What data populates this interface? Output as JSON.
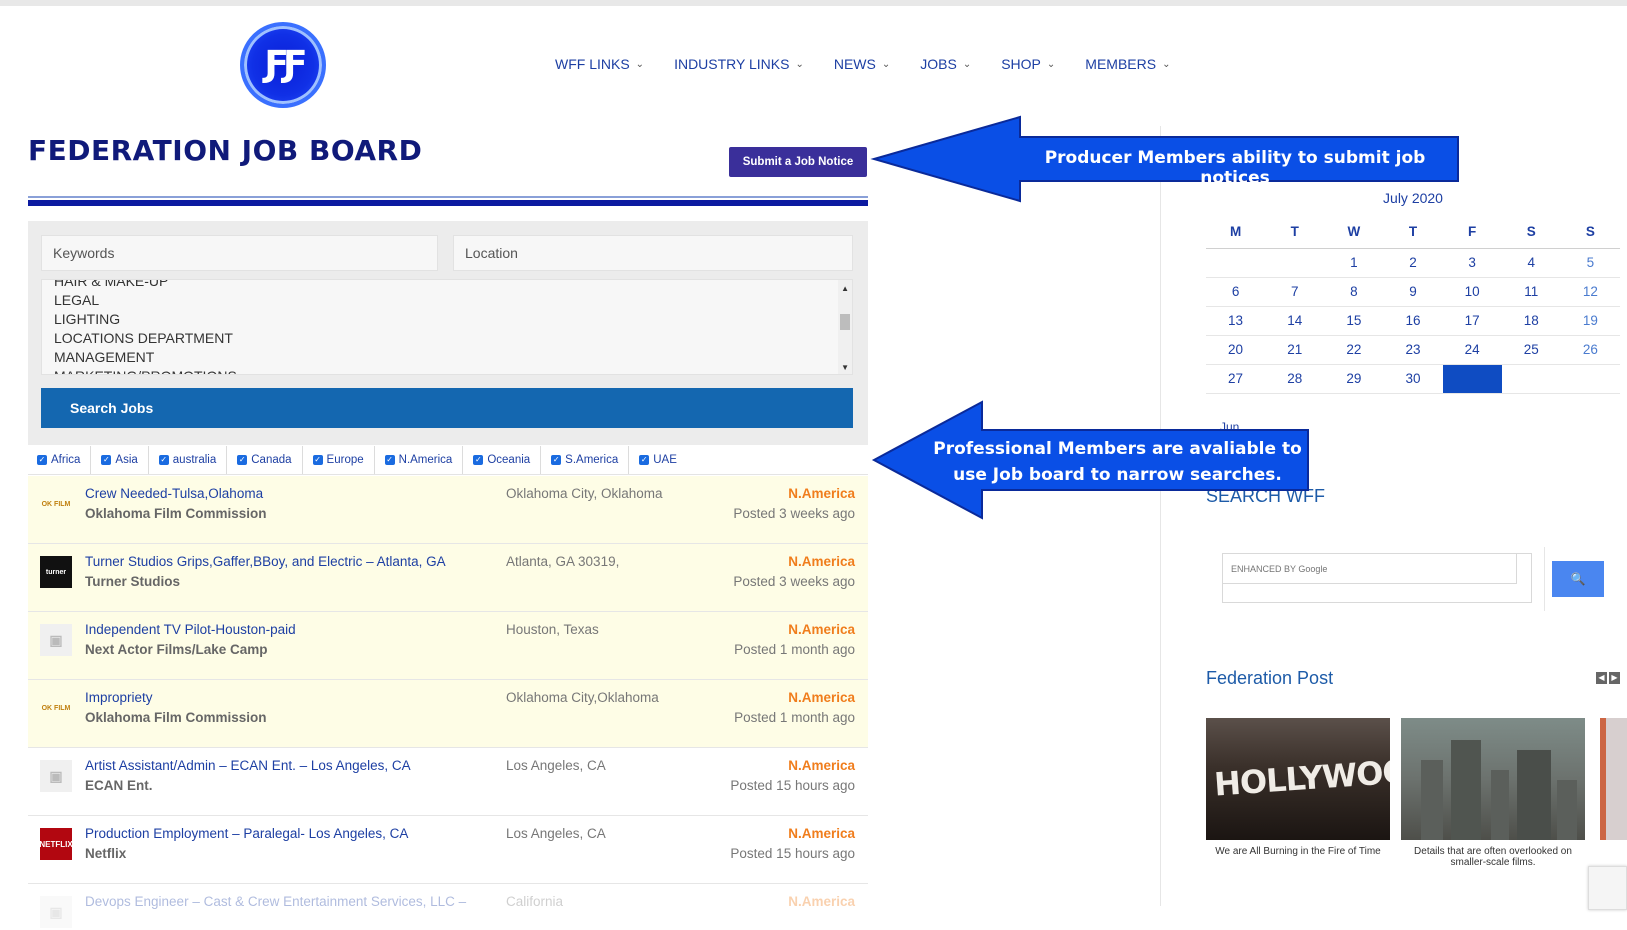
{
  "nav": {
    "items": [
      {
        "label": "WFF LINKS"
      },
      {
        "label": "INDUSTRY LINKS"
      },
      {
        "label": "NEWS"
      },
      {
        "label": "JOBS"
      },
      {
        "label": "SHOP"
      },
      {
        "label": "MEMBERS"
      }
    ]
  },
  "page": {
    "title": "FEDERATION JOB BOARD",
    "submit_label": "Submit a Job Notice"
  },
  "filters": {
    "keywords_placeholder": "Keywords",
    "location_placeholder": "Location",
    "categories": [
      "HAIR & MAKE-UP",
      "LEGAL",
      "LIGHTING",
      "LOCATIONS DEPARTMENT",
      "MANAGEMENT",
      "MARKETING/PROMOTIONS"
    ],
    "search_label": "Search Jobs",
    "regions": [
      "Africa",
      "Asia",
      "australia",
      "Canada",
      "Europe",
      "N.America",
      "Oceania",
      "S.America",
      "UAE"
    ]
  },
  "jobs": [
    {
      "title": "Crew Needed-Tulsa,Olahoma",
      "company": "Oklahoma Film Commission",
      "location": "Oklahoma City, Oklahoma",
      "region": "N.America",
      "posted": "Posted 3 weeks ago",
      "featured": true,
      "logo": "ok-film-logo"
    },
    {
      "title": "Turner Studios Grips,Gaffer,BBoy, and Electric – Atlanta, GA",
      "company": "Turner Studios",
      "location": "Atlanta, GA 30319,",
      "region": "N.America",
      "posted": "Posted 3 weeks ago",
      "featured": true,
      "logo": "turner-logo"
    },
    {
      "title": "Independent TV Pilot-Houston-paid",
      "company": "Next Actor Films/Lake Camp",
      "location": "Houston, Texas",
      "region": "N.America",
      "posted": "Posted 1 month ago",
      "featured": true,
      "logo": "placeholder-logo"
    },
    {
      "title": "Impropriety",
      "company": "Oklahoma Film Commission",
      "location": "Oklahoma City,Oklahoma",
      "region": "N.America",
      "posted": "Posted 1 month ago",
      "featured": true,
      "logo": "ok-film-logo"
    },
    {
      "title": "Artist Assistant/Admin – ECAN Ent. – Los Angeles, CA",
      "company": "ECAN Ent.",
      "location": "Los Angeles, CA",
      "region": "N.America",
      "posted": "Posted 15 hours ago",
      "featured": false,
      "logo": "placeholder-logo"
    },
    {
      "title": "Production Employment – Paralegal- Los Angeles, CA",
      "company": "Netflix",
      "location": "Los Angeles, CA",
      "region": "N.America",
      "posted": "Posted 15 hours ago",
      "featured": false,
      "logo": "netflix-logo"
    },
    {
      "title": "Devops Engineer – Cast & Crew Entertainment Services, LLC –",
      "company": "",
      "location": "California",
      "region": "N.America",
      "posted": "",
      "featured": false,
      "logo": "placeholder-logo"
    }
  ],
  "calendar": {
    "caption": "July 2020",
    "headers": [
      "M",
      "T",
      "W",
      "T",
      "F",
      "S",
      "S"
    ],
    "weeks": [
      [
        "",
        "",
        "1",
        "2",
        "3",
        "4",
        "5"
      ],
      [
        "6",
        "7",
        "8",
        "9",
        "10",
        "11",
        "12"
      ],
      [
        "13",
        "14",
        "15",
        "16",
        "17",
        "18",
        "19"
      ],
      [
        "20",
        "21",
        "22",
        "23",
        "24",
        "25",
        "26"
      ],
      [
        "27",
        "28",
        "29",
        "30",
        "",
        "",
        ""
      ]
    ],
    "prev_label": "Jun"
  },
  "sidebar": {
    "search_title": "SEARCH WFF",
    "search_placeholder": "ENHANCED BY Google",
    "fed_title": "Federation Post",
    "posts": [
      {
        "caption": "We are All Burning in the Fire of Time",
        "image_text": "HOLLYWOOD"
      },
      {
        "caption": "Details that are often overlooked on smaller-scale films."
      }
    ]
  },
  "annotations": {
    "producer": "Producer Members ability to submit job notices",
    "professional_line1": "Professional Members are avaliable to",
    "professional_line2": "use Job board to narrow searches."
  },
  "colors": {
    "title": "#101a7a",
    "link": "#1d3fa3",
    "region": "#f07d1c",
    "search_button": "#1467b0",
    "annotation": "#0a4fe6"
  }
}
